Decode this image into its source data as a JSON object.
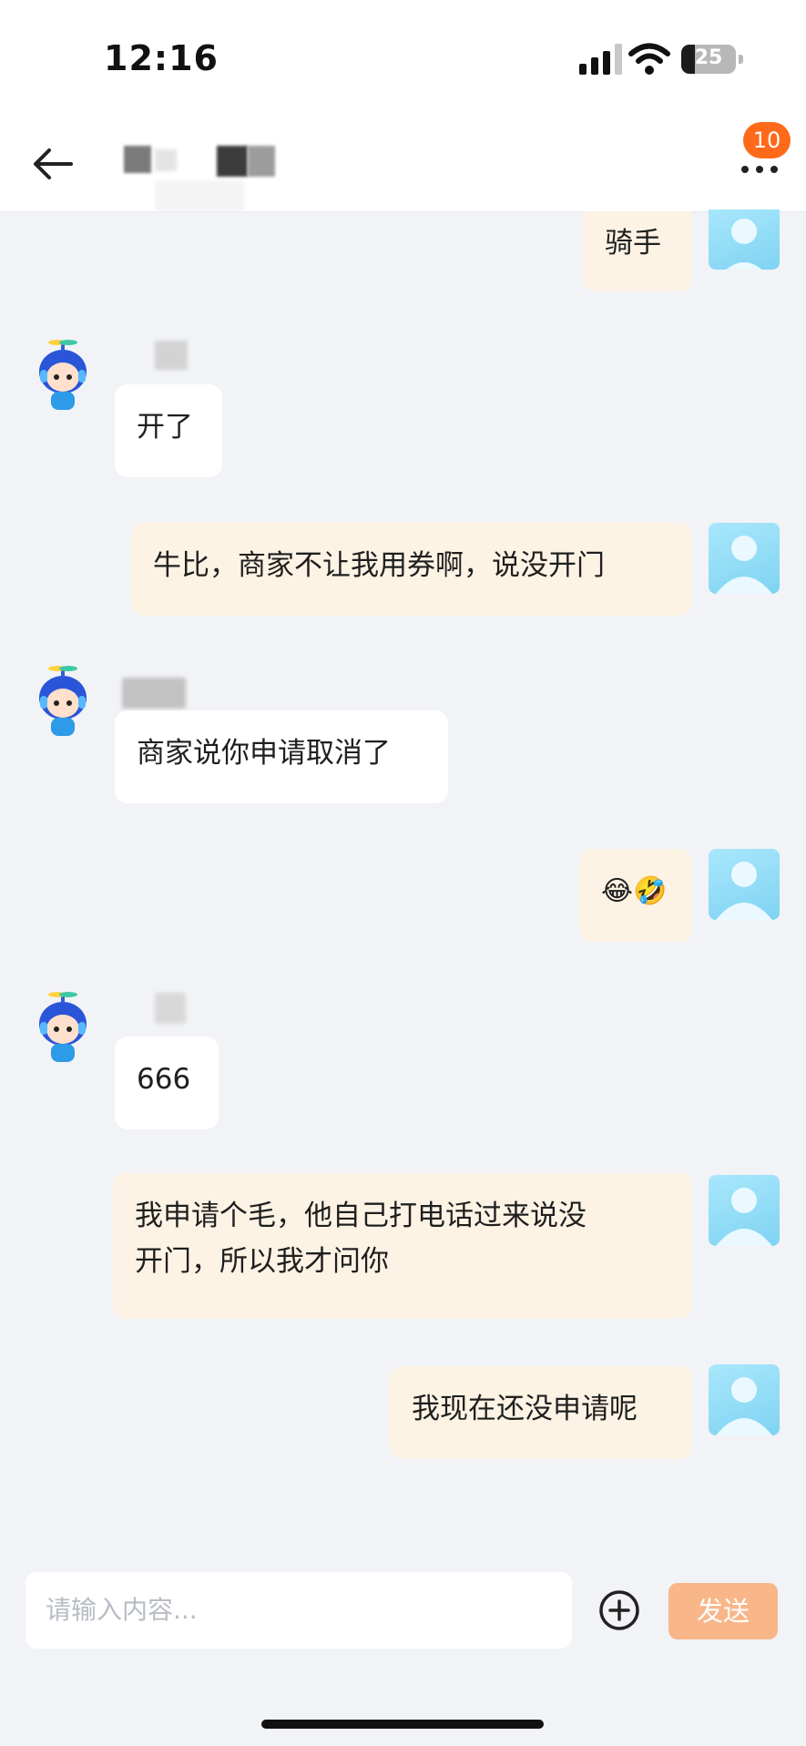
{
  "status_bar": {
    "time": "12:16",
    "battery": "25",
    "battery_level": 0.25
  },
  "header": {
    "badge_count": "10",
    "title": ""
  },
  "messages": [
    {
      "side": "me",
      "text": "骑手"
    },
    {
      "side": "other",
      "text": "开了"
    },
    {
      "side": "me",
      "text": "牛比，商家不让我用券啊，说没开门"
    },
    {
      "side": "other",
      "text": "商家说你申请取消了"
    },
    {
      "side": "me",
      "text": "😂🤣"
    },
    {
      "side": "other",
      "text": "666"
    },
    {
      "side": "me",
      "text_line1": "我申请个毛，他自己打电话过来说没",
      "text_line2": "开门，所以我才问你"
    },
    {
      "side": "me",
      "text": "我现在还没申请呢"
    }
  ],
  "composer": {
    "placeholder": "请输入内容...",
    "send_label": "发送"
  },
  "colors": {
    "accent": "#ff6a1a",
    "send_button": "#f8b689",
    "my_bubble": "#fdf3e5",
    "other_bubble": "#ffffff",
    "background": "#f1f3f6"
  },
  "icons": [
    "signal-icon",
    "wifi-icon",
    "battery-icon",
    "back-arrow-icon",
    "more-dots-icon",
    "plus-circle-icon"
  ]
}
